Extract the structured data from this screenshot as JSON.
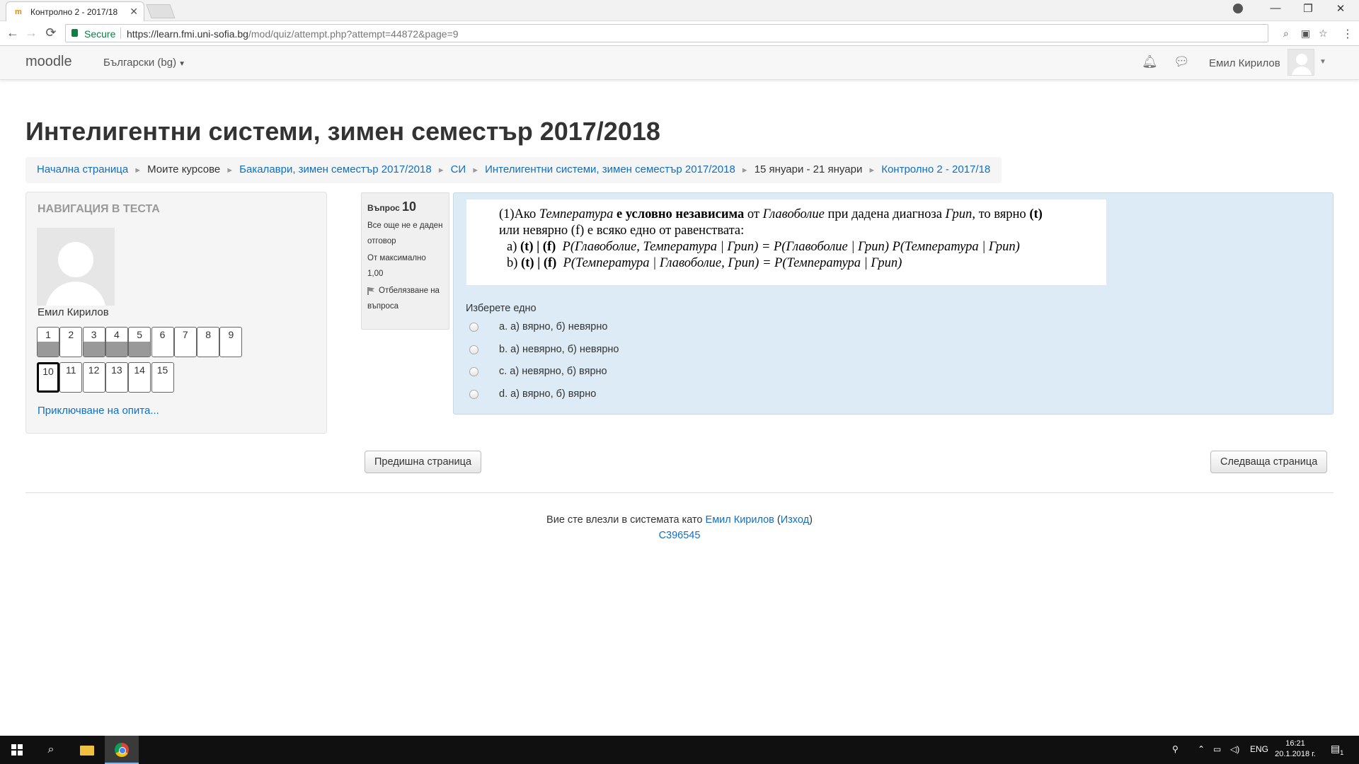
{
  "browser": {
    "tab_title": "Контролно 2 - 2017/18",
    "secure_label": "Secure",
    "url_host": "https://learn.fmi.uni-sofia.bg",
    "url_path": "/mod/quiz/attempt.php?attempt=44872&page=9"
  },
  "navbar": {
    "brand": "moodle",
    "language": "Български (bg)",
    "username": "Емил Кирилов"
  },
  "page": {
    "title": "Интелигентни системи, зимен семестър 2017/2018"
  },
  "breadcrumb": [
    {
      "label": "Начална страница",
      "link": true
    },
    {
      "label": "Моите курсове",
      "link": false
    },
    {
      "label": "Бакалаври, зимен семестър 2017/2018",
      "link": true
    },
    {
      "label": "СИ",
      "link": true
    },
    {
      "label": "Интелигентни системи, зимен семестър 2017/2018",
      "link": true
    },
    {
      "label": "15 януари - 21 януари",
      "link": false
    },
    {
      "label": "Контролно 2 - 2017/18",
      "link": true
    }
  ],
  "quiz_nav": {
    "title": "НАВИГАЦИЯ В ТЕСТА",
    "user_name": "Емил Кирилов",
    "finish_link": "Приключване на опита...",
    "questions": [
      {
        "label": "1",
        "answered": true,
        "current": false
      },
      {
        "label": "2",
        "answered": false,
        "current": false
      },
      {
        "label": "3",
        "answered": true,
        "current": false
      },
      {
        "label": "4",
        "answered": true,
        "current": false
      },
      {
        "label": "5",
        "answered": true,
        "current": false
      },
      {
        "label": "6",
        "answered": false,
        "current": false
      },
      {
        "label": "7",
        "answered": false,
        "current": false
      },
      {
        "label": "8",
        "answered": false,
        "current": false
      },
      {
        "label": "9",
        "answered": false,
        "current": false
      },
      {
        "label": "10",
        "answered": false,
        "current": true
      },
      {
        "label": "11",
        "answered": false,
        "current": false
      },
      {
        "label": "12",
        "answered": false,
        "current": false
      },
      {
        "label": "13",
        "answered": false,
        "current": false
      },
      {
        "label": "14",
        "answered": false,
        "current": false
      },
      {
        "label": "15",
        "answered": false,
        "current": false
      }
    ]
  },
  "question_info": {
    "question_label": "Въпрос",
    "question_number": "10",
    "state": "Все още не е даден отговор",
    "max_marks": "От максимално 1,00",
    "flag_label": "Отбелязване на въпроса"
  },
  "question": {
    "text_line1_prefix": "(1)Ако ",
    "text_line1_temp": "Температура",
    "text_line1_bold": " е условно независима",
    "text_line1_mid": " от ",
    "text_line1_head": "Главоболие",
    "text_line1_rest": " при дадена диагноза ",
    "text_line1_flu": "Грип",
    "text_line1_end": ", то вярно ",
    "text_line1_t": "(t)",
    "text_line2": "или невярно (f) е всяко едно от равенствата:",
    "text_line3_prefix": "а) ",
    "text_line3_tf": "(t) | (f)",
    "text_line3_eq": "P(Главоболие, Температура | Грип) = P(Главоболие | Грип) P(Температура | Грип)",
    "text_line4_prefix": "b) ",
    "text_line4_tf": "(t) | (f)",
    "text_line4_eq": "P(Температура | Главоболие, Грип) = P(Температура | Грип)",
    "prompt": "Изберете едно",
    "options": [
      "a. а) вярно, б) невярно",
      "b. а) невярно, б) невярно",
      "c. а) невярно, б) вярно",
      "d. а) вярно, б) вярно"
    ]
  },
  "buttons": {
    "prev": "Предишна страница",
    "next": "Следваща страница"
  },
  "footer": {
    "logged_in_prefix": "Вие сте влезли в системата като ",
    "user_link": "Емил Кирилов",
    "logout_open": " (",
    "logout_link": "Изход",
    "logout_close": ")",
    "code": "C396545"
  },
  "taskbar": {
    "lang": "ENG",
    "time": "16:21",
    "date": "20.1.2018 г.",
    "notifications": "1"
  }
}
